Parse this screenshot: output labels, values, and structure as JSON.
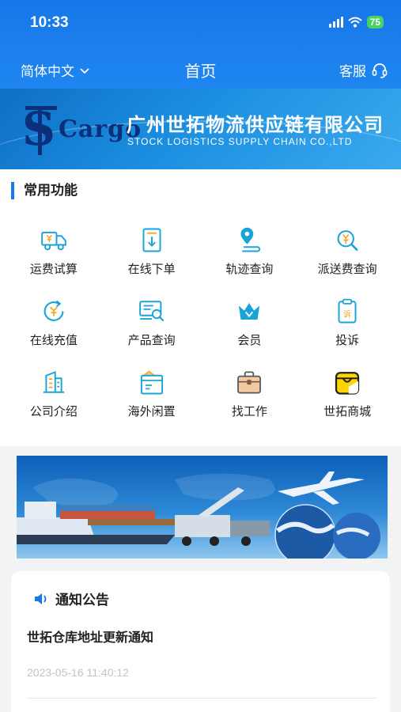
{
  "status_bar": {
    "time": "10:33",
    "battery": "75"
  },
  "nav": {
    "language": "简体中文",
    "title": "首页",
    "service": "客服"
  },
  "brand": {
    "logo_text": "Cargo",
    "name_cn": "广州世拓物流供应链有限公司",
    "name_en": "STOCK LOGISTICS SUPPLY CHAIN CO.,LTD"
  },
  "functions": {
    "title": "常用功能",
    "items": [
      {
        "label": "运费试算",
        "icon": "truck-yen-icon"
      },
      {
        "label": "在线下单",
        "icon": "order-download-icon"
      },
      {
        "label": "轨迹查询",
        "icon": "location-pin-icon"
      },
      {
        "label": "派送费查询",
        "icon": "yen-search-icon"
      },
      {
        "label": "在线充值",
        "icon": "yen-refresh-icon"
      },
      {
        "label": "产品查询",
        "icon": "product-search-icon"
      },
      {
        "label": "会员",
        "icon": "crown-icon"
      },
      {
        "label": "投诉",
        "icon": "complaint-clipboard-icon"
      },
      {
        "label": "公司介绍",
        "icon": "building-icon"
      },
      {
        "label": "海外闲置",
        "icon": "box-icon"
      },
      {
        "label": "找工作",
        "icon": "briefcase-icon"
      },
      {
        "label": "世拓商城",
        "icon": "shopping-bag-icon"
      }
    ]
  },
  "notice": {
    "title": "通知公告",
    "item_title": "世拓仓库地址更新通知",
    "item_date": "2023-05-16 11:40:12"
  },
  "colors": {
    "primary": "#1677e8",
    "icon_teal": "#1aa3d6",
    "icon_yellow": "#f5a623"
  }
}
